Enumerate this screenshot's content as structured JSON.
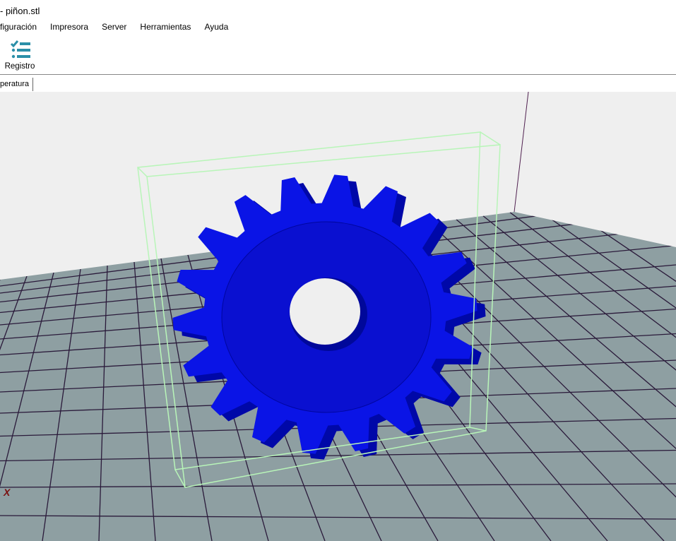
{
  "window": {
    "title": "- piñon.stl"
  },
  "menu": [
    "figuración",
    "Impresora",
    "Server",
    "Herramientas",
    "Ayuda"
  ],
  "toolbar": {
    "registro_label": "Registro"
  },
  "tabs": [
    "peratura"
  ],
  "viewport": {
    "axis_label": "X",
    "model_color": "#0a14e6",
    "floor_color": "#8e9fa2",
    "bbox_color": "#b8f5b8"
  }
}
